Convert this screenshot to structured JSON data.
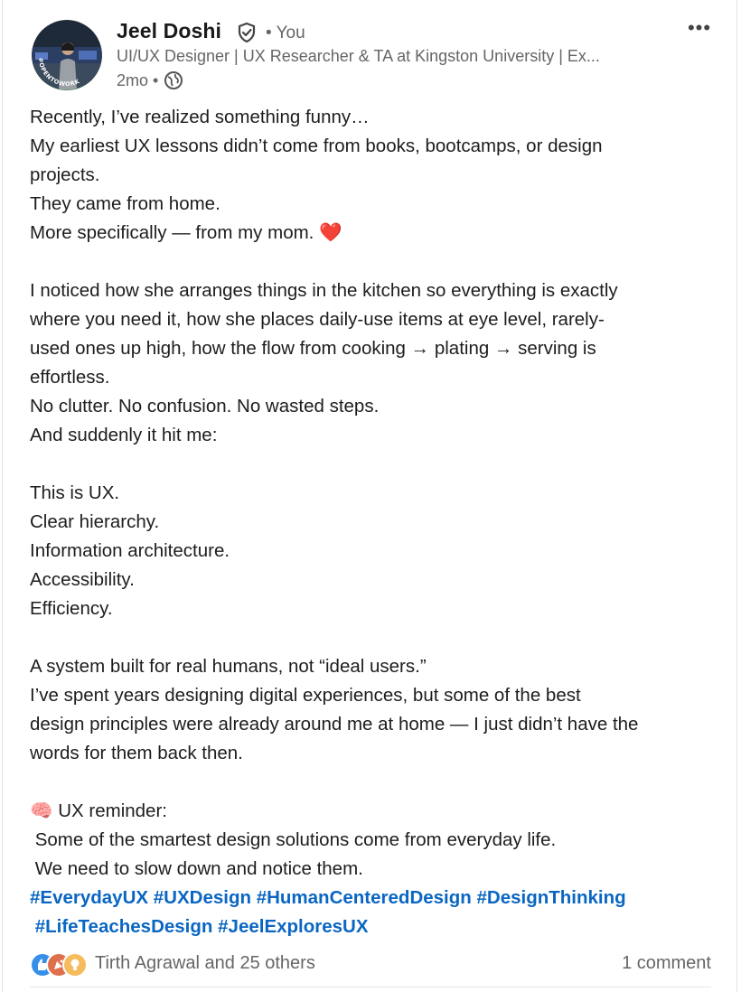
{
  "post": {
    "author": {
      "name": "Jeel Doshi",
      "relation": "• You",
      "headline": "UI/UX Designer | UX Researcher & TA at Kingston University | Ex...",
      "time": "2mo •",
      "avatar_badge": "#OPENTOWORK"
    },
    "icons": {
      "verified": "verified-shield-icon",
      "visibility": "globe-icon",
      "more": "more-options-icon"
    },
    "more_label": "•••",
    "body": {
      "p1": [
        "Recently, I’ve realized something funny…",
        "My earliest UX lessons didn’t come from books, bootcamps, or design",
        "projects.",
        "They came from home.",
        "More specifically — from my mom. "
      ],
      "heart": "❤️",
      "p2": [
        "I noticed how she arranges things in the kitchen so everything is exactly",
        "where you need it, how she places daily-use items at eye level, rarely-",
        "used ones up high, how the flow from cooking → plating → serving is",
        "effortless.",
        "No clutter. No confusion. No wasted steps.",
        "And suddenly it hit me:"
      ],
      "p3": [
        "This is UX.",
        "Clear hierarchy.",
        "Information architecture.",
        "Accessibility.",
        "Efficiency."
      ],
      "p4": [
        "A system built for real humans, not “ideal users.”",
        "I’ve spent years designing digital experiences, but some of the best",
        "design principles were already around me at home — I just didn’t have the",
        "words for them back then."
      ],
      "p5": [
        "🧠 UX reminder:",
        " Some of the smartest design solutions come from everyday life.",
        " We need to slow down and notice them."
      ]
    },
    "hashtags_line1": [
      "#EverydayUX",
      "#UXDesign",
      "#HumanCenteredDesign",
      "#DesignThinking"
    ],
    "hashtags_line2": [
      "#LifeTeachesDesign",
      "#JeelExploresUX"
    ],
    "reactions": {
      "text": "Tirth Agrawal and 25 others",
      "icons": [
        "like-icon",
        "celebrate-icon",
        "insightful-icon"
      ],
      "colors": [
        "#378fe9",
        "#df704d",
        "#f5bb5c"
      ]
    },
    "comments": "1 comment"
  }
}
